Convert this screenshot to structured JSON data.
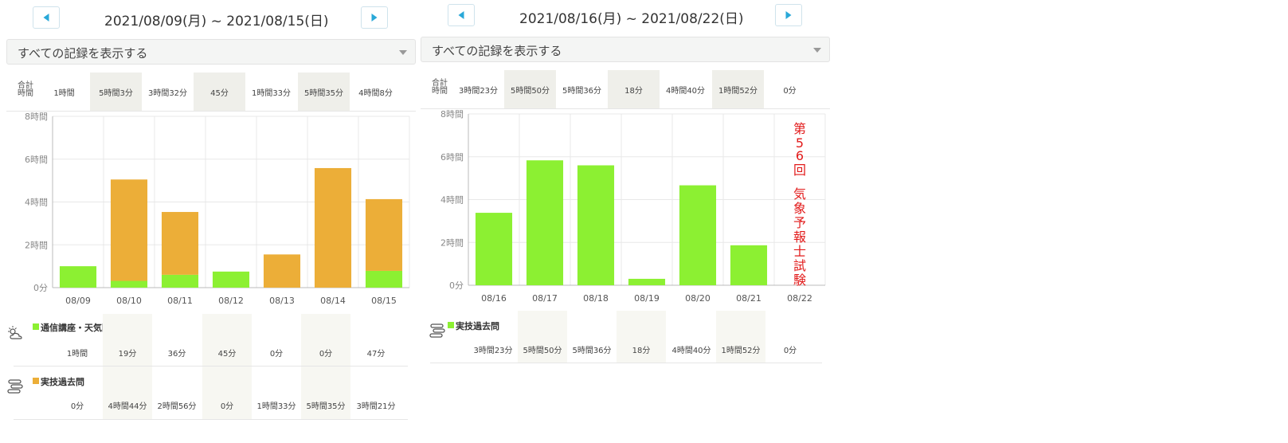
{
  "weeks": [
    {
      "range": "2021/08/09(月) ~ 2021/08/15(日)",
      "filter": "すべての記録を表示する",
      "totals_label": "合計時間",
      "totals": [
        "1時間",
        "5時間3分",
        "3時間32分",
        "45分",
        "1時間33分",
        "5時間35分",
        "4時間8分"
      ],
      "breakdown": [
        {
          "name": "通信講座・天気図解析",
          "icon": "weather-icon",
          "color": "#8cf032",
          "values": [
            "1時間",
            "19分",
            "36分",
            "45分",
            "0分",
            "0分",
            "47分"
          ]
        },
        {
          "name": "実技過去問",
          "icon": "stack-icon",
          "color": "#ecae38",
          "values": [
            "0分",
            "4時間44分",
            "2時間56分",
            "0分",
            "1時間33分",
            "5時間35分",
            "3時間21分"
          ]
        }
      ]
    },
    {
      "range": "2021/08/16(月) ~ 2021/08/22(日)",
      "filter": "すべての記録を表示する",
      "totals_label": "合計時間",
      "totals": [
        "3時間23分",
        "5時間50分",
        "5時間36分",
        "18分",
        "4時間40分",
        "1時間52分",
        "0分"
      ],
      "annotation": "第56回 気象予報士試験",
      "breakdown": [
        {
          "name": "実技過去問",
          "icon": "stack-icon",
          "color": "#8cf032",
          "values": [
            "3時間23分",
            "5時間50分",
            "5時間36分",
            "18分",
            "4時間40分",
            "1時間52分",
            "0分"
          ]
        }
      ]
    }
  ],
  "chart_data": [
    {
      "type": "bar",
      "stacked": true,
      "categories": [
        "08/09",
        "08/10",
        "08/11",
        "08/12",
        "08/13",
        "08/14",
        "08/15"
      ],
      "y_ticks": [
        "0分",
        "2時間",
        "4時間",
        "6時間",
        "8時間"
      ],
      "ylim_minutes": [
        0,
        480
      ],
      "series": [
        {
          "name": "通信講座・天気図解析",
          "color": "#8cf032",
          "values_minutes": [
            60,
            19,
            36,
            45,
            0,
            0,
            47
          ]
        },
        {
          "name": "実技過去問",
          "color": "#ecae38",
          "values_minutes": [
            0,
            284,
            176,
            0,
            93,
            335,
            201
          ]
        }
      ],
      "grid": true
    },
    {
      "type": "bar",
      "stacked": true,
      "categories": [
        "08/16",
        "08/17",
        "08/18",
        "08/19",
        "08/20",
        "08/21",
        "08/22"
      ],
      "y_ticks": [
        "0分",
        "2時間",
        "4時間",
        "6時間",
        "8時間"
      ],
      "ylim_minutes": [
        0,
        480
      ],
      "series": [
        {
          "name": "実技過去問",
          "color": "#8cf032",
          "values_minutes": [
            203,
            350,
            336,
            18,
            280,
            112,
            0
          ]
        }
      ],
      "grid": true
    }
  ]
}
